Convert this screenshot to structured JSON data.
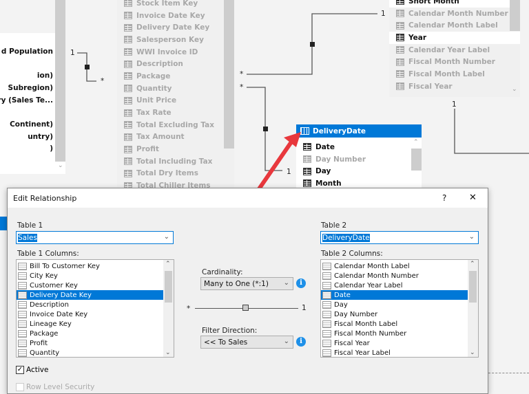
{
  "diagram": {
    "left_table": {
      "items": [
        "d Population",
        "",
        "ion)",
        "Subregion)",
        "ry (Sales Te...",
        "",
        "Continent)",
        "untry)",
        ")"
      ]
    },
    "sales_table": {
      "items": [
        "Stock Item Key",
        "Invoice Date Key",
        "Delivery Date Key",
        "Salesperson Key",
        "WWI Invoice ID",
        "Description",
        "Package",
        "Quantity",
        "Unit Price",
        "Tax Rate",
        "Total Excluding Tax",
        "Tax Amount",
        "Profit",
        "Total Including Tax",
        "Total Dry Items",
        "Total Chiller Items"
      ]
    },
    "date_table": {
      "items": [
        {
          "label": "Short Month",
          "active": true
        },
        {
          "label": "Calendar Month Number",
          "active": false
        },
        {
          "label": "Calendar Month Label",
          "active": false
        },
        {
          "label": "Year",
          "active": true
        },
        {
          "label": "Calendar Year Label",
          "active": false
        },
        {
          "label": "Fiscal Month Number",
          "active": false
        },
        {
          "label": "Fiscal Month Label",
          "active": false
        },
        {
          "label": "Fiscal Year",
          "active": false
        }
      ]
    },
    "delivery_date_table": {
      "title": "DeliveryDate",
      "items": [
        {
          "label": "Date",
          "active": true
        },
        {
          "label": "Day Number",
          "active": false
        },
        {
          "label": "Day",
          "active": true
        },
        {
          "label": "Month",
          "active": true
        }
      ]
    },
    "cardinality_labels": {
      "one": "1",
      "many": "*"
    },
    "arrow_color": "#e8383d",
    "header_color": "#0078d7"
  },
  "dialog": {
    "title": "Edit Relationship",
    "help": "?",
    "close": "✕",
    "table1": {
      "label": "Table 1",
      "value": "Sales",
      "columns_label": "Table 1 Columns:",
      "columns": [
        "Bill To Customer Key",
        "City Key",
        "Customer Key",
        "Delivery Date Key",
        "Description",
        "Invoice Date Key",
        "Lineage Key",
        "Package",
        "Profit",
        "Quantity"
      ],
      "selected": "Delivery Date Key"
    },
    "table2": {
      "label": "Table 2",
      "value": "DeliveryDate",
      "columns_label": "Table 2 Columns:",
      "columns": [
        "Calendar Month Label",
        "Calendar Month Number",
        "Calendar Year Label",
        "Date",
        "Day",
        "Day Number",
        "Fiscal Month Label",
        "Fiscal Month Number",
        "Fiscal Year",
        "Fiscal Year Label"
      ],
      "selected": "Date"
    },
    "cardinality": {
      "label": "Cardinality:",
      "value": "Many to One (*:1)",
      "many": "*",
      "one": "1"
    },
    "filter_direction": {
      "label": "Filter Direction:",
      "value": "<< To Sales"
    },
    "active": {
      "label": "Active",
      "checked": true
    },
    "row_level_security": {
      "label": "Row Level Security",
      "checked": false
    }
  }
}
